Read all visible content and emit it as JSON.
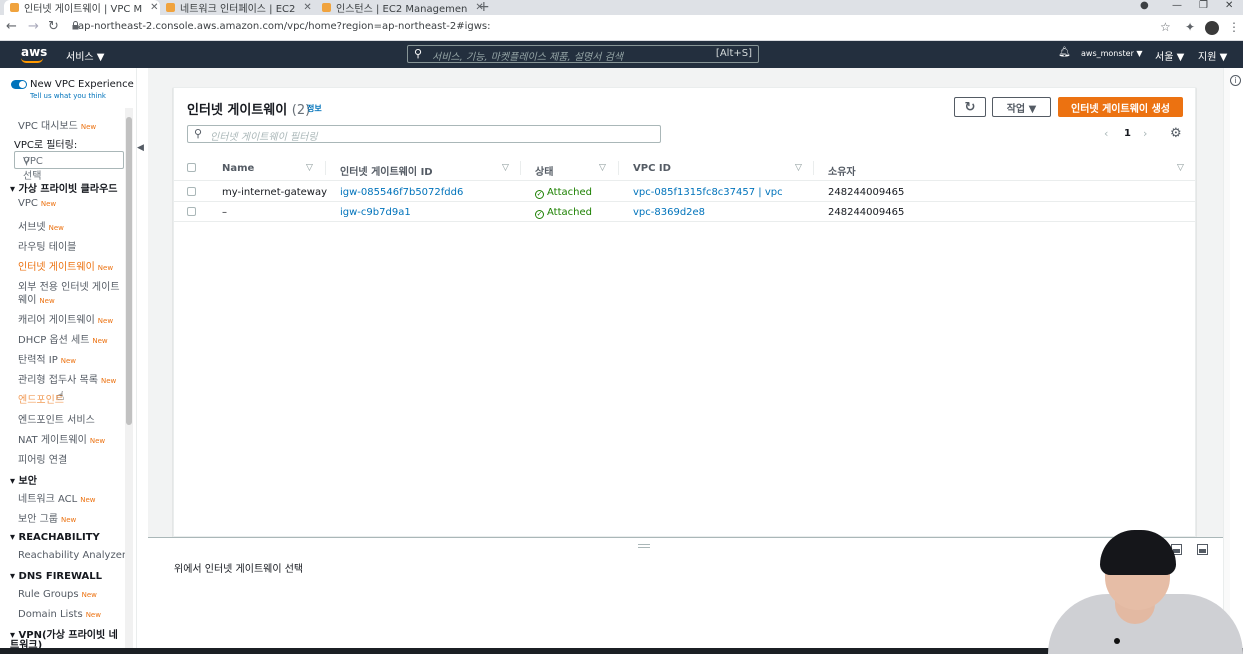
{
  "browser": {
    "tabs": [
      {
        "title": "인터넷 게이트웨이 | VPC M",
        "close": "✕"
      },
      {
        "title": "네트워크 인터페이스 | EC2",
        "close": "✕"
      },
      {
        "title": "인스턴스 | EC2 Managemen",
        "close": "✕"
      }
    ],
    "new_tab": "+",
    "url": "ap-northeast-2.console.aws.amazon.com/vpc/home?region=ap-northeast-2#igws:"
  },
  "aws_header": {
    "logo": "aws",
    "services": "서비스 ▼",
    "search_placeholder": "서비스, 기능, 마켓플레이스 제품, 설명서 검색",
    "search_shortcut": "[Alt+S]",
    "user": "aws_monster ▼",
    "region": "서울 ▼",
    "support": "지원 ▼"
  },
  "sidebar": {
    "new_vpc_experience": "New VPC Experience",
    "tell_us": "Tell us what you think",
    "dashboard": "VPC 대시보드",
    "filter_label": "VPC로 필터링:",
    "vpc_select_placeholder": "VPC 선택",
    "new_badge": "New",
    "sections": {
      "virtual_cloud": "가상 프라이빗 클라우드",
      "security": "보안",
      "reachability": "REACHABILITY",
      "dns_firewall": "DNS FIREWALL",
      "vpn": "VPN(가상 프라이빗 네트워크)"
    },
    "items": {
      "vpc": "VPC",
      "subnets": "서브넷",
      "route_tables": "라우팅 테이블",
      "internet_gateways": "인터넷 게이트웨이",
      "egress_only_1": "외부 전용 인터넷 게이트",
      "egress_only_2": "웨이",
      "carrier_gateways": "캐리어 게이트웨이",
      "dhcp": "DHCP 옵션 세트",
      "elastic_ip": "탄력적 IP",
      "managed_prefix": "관리형 접두사 목록",
      "endpoints": "엔드포인트",
      "endpoint_services": "엔드포인트 서비스",
      "nat_gateways": "NAT 게이트웨이",
      "peering": "피어링 연결",
      "network_acl": "네트워크 ACL",
      "security_groups": "보안 그룹",
      "reachability_analyzer": "Reachability Analyzer",
      "rule_groups": "Rule Groups",
      "domain_lists": "Domain Lists"
    }
  },
  "main": {
    "title": "인터넷 게이트웨이",
    "count": "(2)",
    "info": "정보",
    "actions_button": "작업 ▼",
    "create_button": "인터넷 게이트웨이 생성",
    "filter_placeholder": "인터넷 게이트웨이 필터링",
    "page": "1",
    "columns": [
      "Name",
      "인터넷 게이트웨이 ID",
      "상태",
      "VPC ID",
      "소유자"
    ],
    "rows": [
      {
        "name": "my-internet-gateway",
        "id": "igw-085546f7b5072fdd6",
        "state": "Attached",
        "vpc": "vpc-085f1315fc8c37457 | vpc",
        "owner": "248244009465"
      },
      {
        "name": "–",
        "id": "igw-c9b7d9a1",
        "state": "Attached",
        "vpc": "vpc-8369d2e8",
        "owner": "248244009465"
      }
    ],
    "detail_hint": "위에서 인터넷 게이트웨이 선택"
  }
}
